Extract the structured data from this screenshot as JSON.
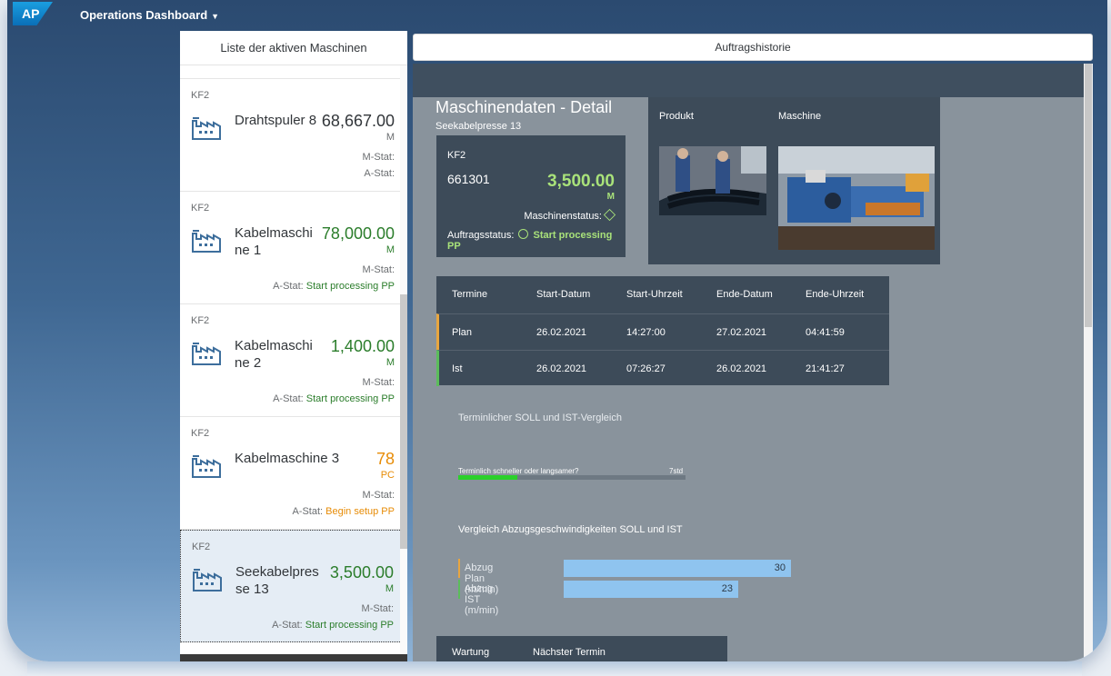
{
  "shell": {
    "logo": "AP",
    "title": "Operations Dashboard",
    "caret": "▼"
  },
  "master": {
    "title": "Liste der aktiven Maschinen",
    "items": [
      {
        "plant": "KF2",
        "name": "Drahtspuler 8",
        "qty": "68,667.00",
        "unit": "M",
        "mstat_label": "M-Stat:",
        "astat_label": "A-Stat:",
        "astat_value": ""
      },
      {
        "plant": "KF2",
        "name": "Kabelmaschine 1",
        "qty": "78,000.00",
        "unit": "M",
        "mstat_label": "M-Stat:",
        "astat_label": "A-Stat:",
        "astat_value": "Start processing PP"
      },
      {
        "plant": "KF2",
        "name": "Kabelmaschine 2",
        "qty": "1,400.00",
        "unit": "M",
        "mstat_label": "M-Stat:",
        "astat_label": "A-Stat:",
        "astat_value": "Start processing PP"
      },
      {
        "plant": "KF2",
        "name": "Kabelmaschine 3",
        "qty": "78",
        "unit": "PC",
        "mstat_label": "M-Stat:",
        "astat_label": "A-Stat:",
        "astat_value": "Begin setup PP"
      },
      {
        "plant": "KF2",
        "name": "Seekabelpresse 13",
        "qty": "3,500.00",
        "unit": "M",
        "mstat_label": "M-Stat:",
        "astat_label": "A-Stat:",
        "astat_value": "Start processing PP"
      }
    ]
  },
  "tab": {
    "label": "Auftragshistorie"
  },
  "detail": {
    "title": "Maschinendaten - Detail",
    "subtitle": "Seekabelpresse 13",
    "kpi": {
      "plant": "KF2",
      "order": "661301",
      "qty": "3,500.00",
      "unit": "M",
      "machine_status_label": "Maschinenstatus:",
      "order_status_label": "Auftragsstatus:",
      "order_status_value": "Start processing PP"
    },
    "product": {
      "label_product": "Produkt",
      "label_machine": "Maschine"
    },
    "schedule": {
      "headers": [
        "Termine",
        "Start-Datum",
        "Start-Uhrzeit",
        "Ende-Datum",
        "Ende-Uhrzeit"
      ],
      "rows": [
        [
          "Plan",
          "26.02.2021",
          "14:27:00",
          "27.02.2021",
          "04:41:59"
        ],
        [
          "Ist",
          "26.02.2021",
          "07:26:27",
          "26.02.2021",
          "21:41:27"
        ]
      ]
    },
    "compare": {
      "title": "Terminlicher SOLL und IST-Vergleich",
      "bar_label": "Terminlich schneller oder langsamer?",
      "bar_value": "7std",
      "bar_fraction": 0.26
    },
    "speed": {
      "title": "Vergleich Abzugsgeschwindigkeiten SOLL und IST",
      "max": 30,
      "rows": [
        {
          "label": "Abzug Plan (m/min)",
          "value": 30
        },
        {
          "label": "Abzug IST (m/min)",
          "value": 23
        }
      ]
    },
    "maintenance": {
      "col1": "Wartung",
      "col2": "Nächster Termin"
    }
  },
  "colors": {
    "accent_green": "#2b7d2b",
    "accent_orange": "#e78c07",
    "kpi_green": "#a9e27a",
    "bar_blue": "#8fc4ef"
  },
  "icons": {
    "machine": "factory-icon",
    "status": "status-icon"
  }
}
